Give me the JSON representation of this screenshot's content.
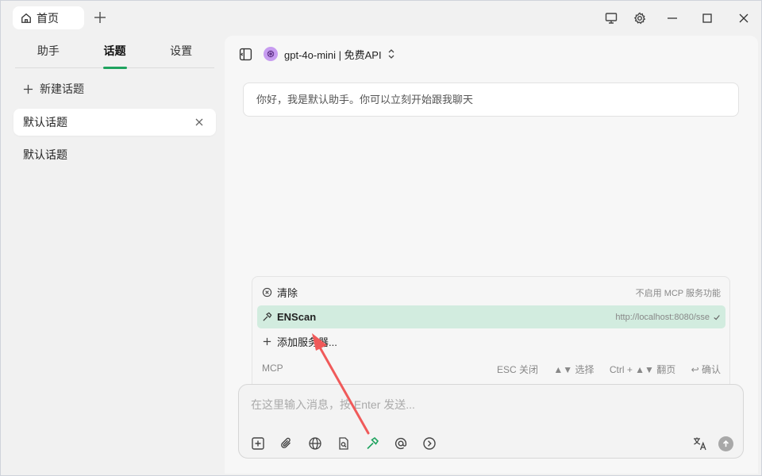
{
  "titlebar": {
    "home_tab_label": "首页"
  },
  "sidebar": {
    "tabs": [
      {
        "label": "助手"
      },
      {
        "label": "话题"
      },
      {
        "label": "设置"
      }
    ],
    "new_topic_label": "新建话题",
    "topics": [
      {
        "label": "默认话题"
      },
      {
        "label": "默认话题"
      }
    ]
  },
  "main": {
    "model_label": "gpt-4o-mini | 免费API",
    "greeting": "你好，我是默认助手。你可以立刻开始跟我聊天"
  },
  "mcp": {
    "clear_label": "清除",
    "clear_hint": "不启用 MCP 服务功能",
    "server_name": "ENScan",
    "server_url": "http://localhost:8080/sse",
    "add_server_label": "添加服务器...",
    "footer_label": "MCP",
    "hint_esc": "ESC 关闭",
    "hint_select": "▲▼ 选择",
    "hint_page": "Ctrl + ▲▼ 翻页",
    "hint_confirm": "↩ 确认"
  },
  "input": {
    "placeholder": "在这里输入消息，按 Enter 发送..."
  },
  "colors": {
    "accent": "#1fa35f",
    "selected_row": "#d2ecdf",
    "arrow": "#f05a5a"
  }
}
